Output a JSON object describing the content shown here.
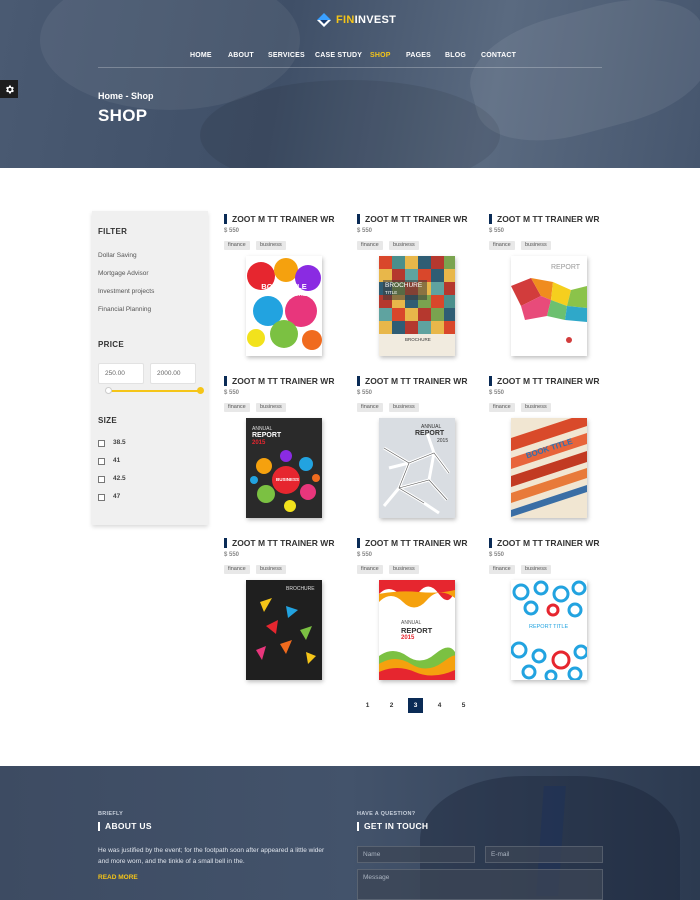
{
  "brand": {
    "name_accent": "FIN",
    "name_rest": "INVEST"
  },
  "nav": {
    "items": [
      "HOME",
      "ABOUT",
      "SERVICES",
      "CASE STUDY",
      "SHOP",
      "PAGES",
      "BLOG",
      "CONTACT"
    ],
    "active": "SHOP"
  },
  "hero": {
    "breadcrumb": "Home - Shop",
    "title": "SHOP"
  },
  "sidebar": {
    "filter_heading": "FILTER",
    "filter_items": [
      "Dollar Saving",
      "Mortgage Advisor",
      "Investment projects",
      "Financial Planning"
    ],
    "price_heading": "PRICE",
    "price_min": "250.00",
    "price_max": "2000.00",
    "size_heading": "SIZE",
    "sizes": [
      "38.5",
      "41",
      "42.5",
      "47"
    ]
  },
  "products": [
    {
      "title": "ZOOT M TT TRAINER WR",
      "price": "$ 550",
      "tags": [
        "finance",
        "business"
      ],
      "cover": "book-title-cover",
      "cover_text": [
        "BOOK TITLE",
        "AUTHOR NAME"
      ]
    },
    {
      "title": "ZOOT M TT TRAINER WR",
      "price": "$ 550",
      "tags": [
        "finance",
        "business"
      ],
      "cover": "brochure-grid-cover",
      "cover_text": [
        "BROCHURE",
        "TITLE",
        "BROCHURE"
      ]
    },
    {
      "title": "ZOOT M TT TRAINER WR",
      "price": "$ 550",
      "tags": [
        "finance",
        "business"
      ],
      "cover": "report-colorful-cover",
      "cover_text": [
        "REPORT"
      ]
    },
    {
      "title": "ZOOT M TT TRAINER WR",
      "price": "$ 550",
      "tags": [
        "finance",
        "business"
      ],
      "cover": "annual-report-bubbles-cover",
      "cover_text": [
        "ANNUAL",
        "REPORT",
        "2015",
        "BUSINESS"
      ]
    },
    {
      "title": "ZOOT M TT TRAINER WR",
      "price": "$ 550",
      "tags": [
        "finance",
        "business"
      ],
      "cover": "annual-report-network-cover",
      "cover_text": [
        "ANNUAL",
        "REPORT",
        "2015"
      ]
    },
    {
      "title": "ZOOT M TT TRAINER WR",
      "price": "$ 550",
      "tags": [
        "finance",
        "business"
      ],
      "cover": "book-title-stripes-cover",
      "cover_text": [
        "BOOK TITLE"
      ]
    },
    {
      "title": "ZOOT M TT TRAINER WR",
      "price": "$ 550",
      "tags": [
        "finance",
        "business"
      ],
      "cover": "brochure-triangles-cover",
      "cover_text": [
        "BROCHURE"
      ]
    },
    {
      "title": "ZOOT M TT TRAINER WR",
      "price": "$ 550",
      "tags": [
        "finance",
        "business"
      ],
      "cover": "annual-report-waves-cover",
      "cover_text": [
        "ANNUAL",
        "REPORT",
        "2015"
      ]
    },
    {
      "title": "ZOOT M TT TRAINER WR",
      "price": "$ 550",
      "tags": [
        "finance",
        "business"
      ],
      "cover": "report-circles-cover",
      "cover_text": [
        "REPORT TITLE"
      ]
    }
  ],
  "pagination": {
    "pages": [
      "1",
      "2",
      "3",
      "4",
      "5"
    ],
    "current": "3"
  },
  "footer": {
    "about_small": "BRIEFLY",
    "about_heading": "ABOUT US",
    "about_text": "He was justified by the event; for the footpath soon after appeared a little wider and more worn, and the tinkle of a small bell in the.",
    "read_more": "READ MORE",
    "contact_small": "HAVE A QUESTION?",
    "contact_heading": "GET IN TOUCH",
    "name_placeholder": "Name",
    "email_placeholder": "E-mail",
    "message_placeholder": "Message"
  },
  "colors": {
    "accent": "#f5c518",
    "navy": "#0a2b56",
    "hero": "#46566e",
    "sidebar_bg": "#f0f0f0"
  },
  "icons": {
    "settings": "gear-icon",
    "logo": "diamond-logo-icon"
  }
}
